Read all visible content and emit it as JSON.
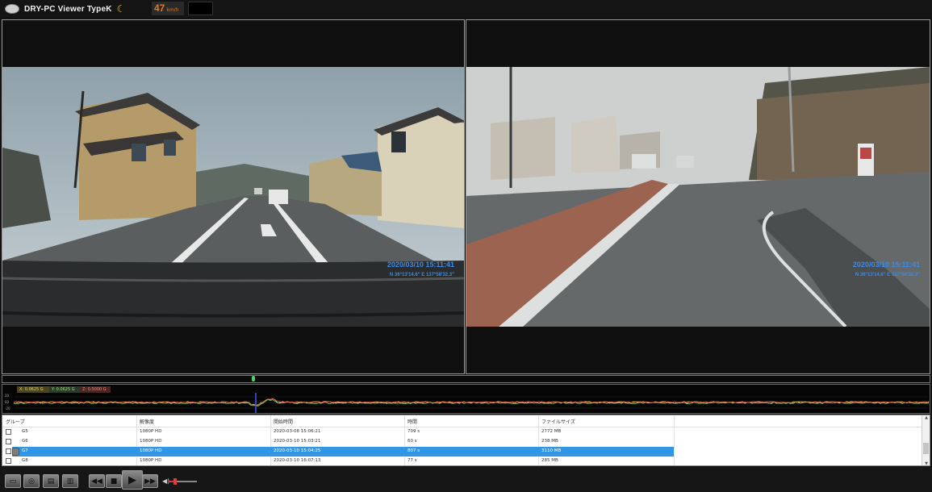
{
  "app": {
    "title": "DRY-PC Viewer TypeK",
    "speed_value": "47",
    "speed_unit": "km/h"
  },
  "videos": {
    "front": {
      "timestamp": "2020/03/10 15:11:41",
      "gps": "N 36°13'14.6\"  E 137°58'32.3\""
    },
    "rear": {
      "timestamp": "2020/03/10 15:11:41",
      "gps": "N 36°13'14.6\"  E 137°58'32.3\""
    }
  },
  "gsensor": {
    "x_label": "X: 0.0625 G",
    "y_label": "Y: 0.0625 G",
    "z_label": "Z: 0.5000 G",
    "scale": [
      "20",
      "00",
      "-20"
    ],
    "colors": {
      "x": "#e8d34a",
      "y": "#7fe05a",
      "z": "#e05a4a"
    }
  },
  "filelist": {
    "columns": [
      "グループ",
      "解像度",
      "開始時間",
      "時間",
      "ファイルサイズ"
    ],
    "rows": [
      {
        "group": "G5",
        "resolution": "1080P HD",
        "start": "2020-03-08 15:06:21",
        "duration": "709 s",
        "size": "2772 MB",
        "selected": false
      },
      {
        "group": "G6",
        "resolution": "1080P HD",
        "start": "2020-03-10 15:03:21",
        "duration": "60 s",
        "size": "238 MB",
        "selected": false
      },
      {
        "group": "G7",
        "resolution": "1080P HD",
        "start": "2020-03-10 15:04:25",
        "duration": "807 s",
        "size": "3110 MB",
        "selected": true
      },
      {
        "group": "G8",
        "resolution": "1080P HD",
        "start": "2020-03-10 16:07:13",
        "duration": "77 s",
        "size": "285 MB",
        "selected": false
      }
    ]
  },
  "playback": {
    "timeline_position": 0.27,
    "volume_level": 0.2
  },
  "colors": {
    "selected_row": "#3296e6",
    "osd_text": "#3b8be8",
    "speed_badge": "#e07a1b"
  }
}
